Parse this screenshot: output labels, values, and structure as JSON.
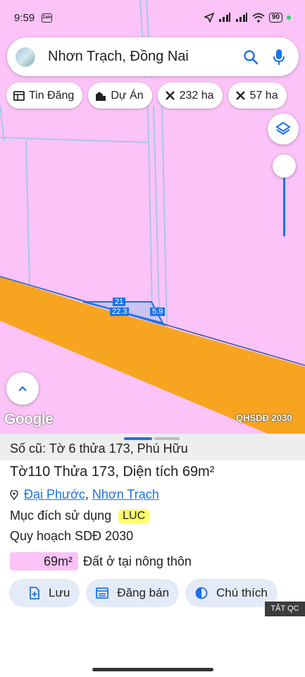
{
  "status_bar": {
    "time": "9:59",
    "app_badge": "Zalo",
    "battery": "90"
  },
  "search": {
    "query": "Nhơn Trạch, Đồng Nai"
  },
  "chips": [
    {
      "label": "Tin Đăng",
      "icon": "newspaper-icon"
    },
    {
      "label": "Dự Án",
      "icon": "building-icon"
    },
    {
      "label": "232 ha",
      "icon": "ruler-icon"
    },
    {
      "label": "57 ha",
      "icon": "ruler-icon"
    }
  ],
  "map": {
    "parcel_labels": {
      "top": "21",
      "middle": "22.3",
      "side": "5.9"
    },
    "attribution": "Google",
    "layer_name": "QHSDĐ 2030",
    "colors": {
      "land": "#fbc3f7",
      "road": "#f7a520",
      "parcel": "#1a73e8"
    }
  },
  "sheet": {
    "old_info": "Số cũ: Tờ 6 thửa 173, Phú Hữu",
    "title_prefix": "Tờ ",
    "sheet_no": "110",
    "title_mid": " Thửa ",
    "plot_no": "173",
    "area_text": ", Diện tích 69m²",
    "location_a": "Đại Phước",
    "location_sep": ", ",
    "location_b": "Nhơn Trạch",
    "usage_label": "Mục đích sử dụng",
    "usage_code": "LUC",
    "planning": "Quy hoạch SDĐ 2030",
    "land_area": "69m²",
    "land_type": "Đất ở tại nông thôn"
  },
  "actions": [
    {
      "label": "Lưu",
      "icon": "save-icon"
    },
    {
      "label": "Đăng bán",
      "icon": "listing-icon"
    },
    {
      "label": "Chú thích",
      "icon": "legend-icon"
    }
  ],
  "clear_label": "TẮT QC"
}
